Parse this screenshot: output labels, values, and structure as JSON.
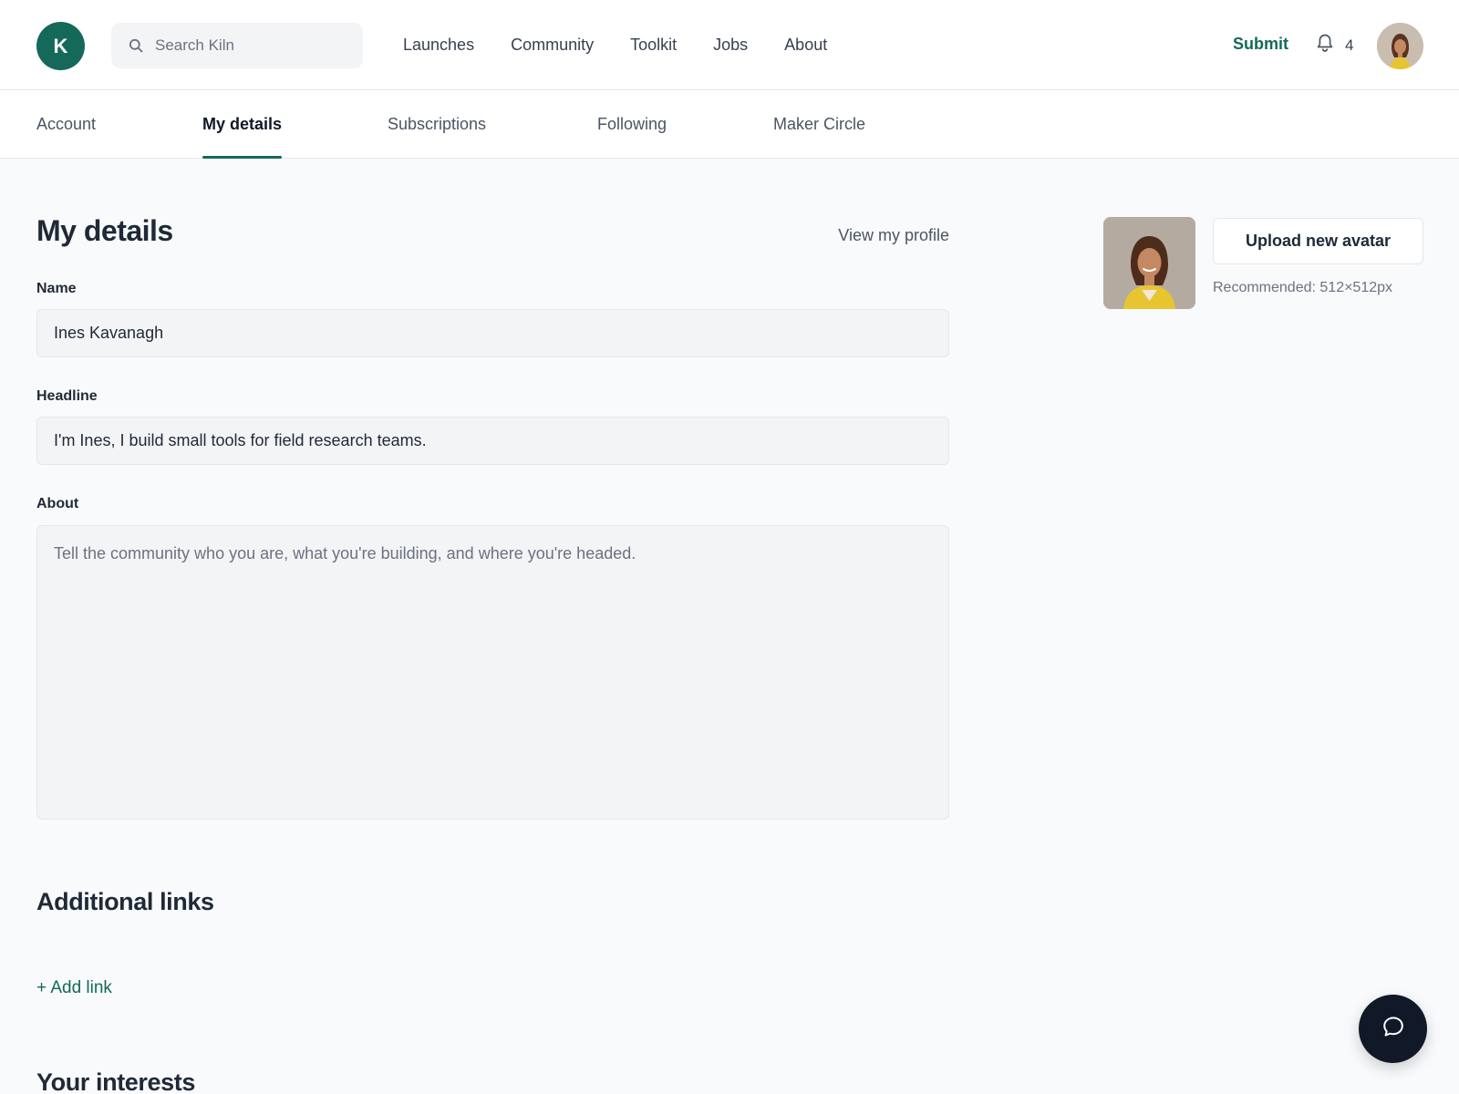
{
  "brand": {
    "logo_letter": "K",
    "accent": "#15695a"
  },
  "header": {
    "search_placeholder": "Search Kiln",
    "nav": [
      {
        "label": "Launches"
      },
      {
        "label": "Community"
      },
      {
        "label": "Toolkit"
      },
      {
        "label": "Jobs"
      },
      {
        "label": "About"
      }
    ],
    "submit_label": "Submit",
    "notification_count": "4"
  },
  "tabs": [
    {
      "label": "Account"
    },
    {
      "label": "My details",
      "active": true
    },
    {
      "label": "Subscriptions"
    },
    {
      "label": "Following"
    },
    {
      "label": "Maker Circle"
    }
  ],
  "details": {
    "title": "My details",
    "view_profile": "View my profile",
    "name_label": "Name",
    "name_value": "Ines Kavanagh",
    "headline_label": "Headline",
    "headline_value": "I'm Ines, I build small tools for field research teams.",
    "about_label": "About",
    "about_placeholder": "Tell the community who you are, what you're building, and where you're headed."
  },
  "avatar": {
    "upload_label": "Upload new avatar",
    "recommended": "Recommended: 512×512px"
  },
  "links": {
    "title": "Additional links",
    "add_label": "+ Add link"
  },
  "interests": {
    "title": "Your interests"
  },
  "icons": {
    "search": "search-icon",
    "bell": "bell-icon",
    "chat": "chat-icon"
  }
}
